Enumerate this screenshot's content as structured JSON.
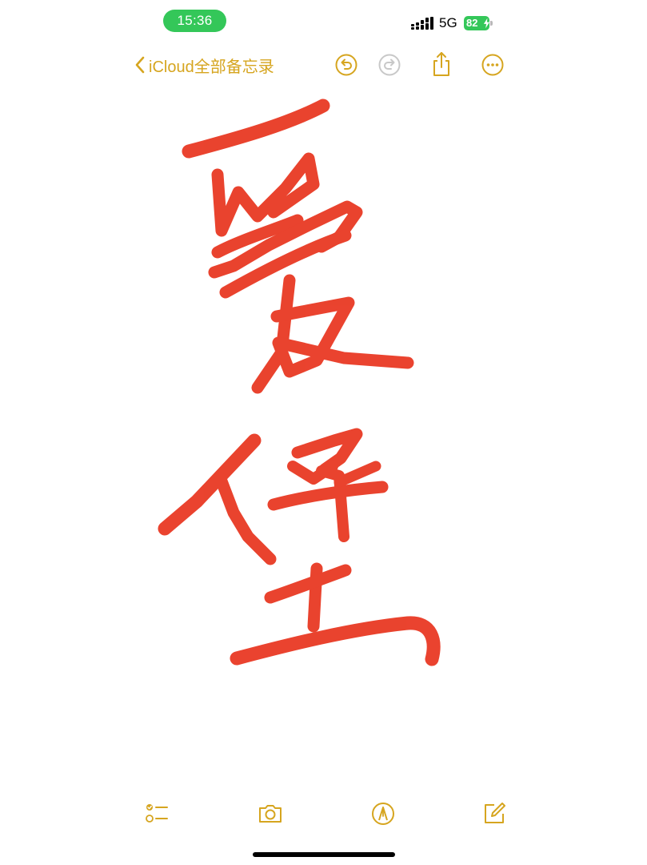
{
  "status_bar": {
    "time": "15:36",
    "network": "5G",
    "battery": "82",
    "time_pill_color": "#34c759",
    "battery_color": "#34c759"
  },
  "nav": {
    "back_label": "iCloud全部备忘录",
    "accent_color": "#d6a51f",
    "buttons": [
      "undo-icon",
      "redo-icon",
      "share-icon",
      "more-icon"
    ]
  },
  "note": {
    "type": "handwritten-drawing",
    "ink_color": "#e8351f"
  },
  "toolbar": {
    "icons": [
      "checklist-icon",
      "camera-icon",
      "markup-pen-icon",
      "compose-icon"
    ]
  }
}
